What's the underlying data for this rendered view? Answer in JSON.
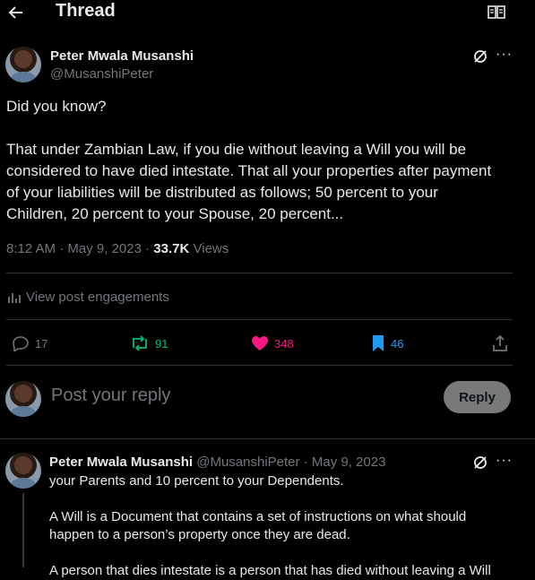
{
  "header": {
    "title": "Thread",
    "back_icon": "arrow-left-icon",
    "reader_icon": "book-open-icon"
  },
  "main_post": {
    "author_name": "Peter Mwala Musanshi",
    "author_handle": "@MusanshiPeter",
    "text_line1": "Did you know?",
    "text_line2": "That under Zambian Law, if you die without leaving a Will you will be",
    "text_line3": "considered to have died intestate. That all your properties after payment",
    "text_line4": "of your liabilities will be distributed as follows; 50 percent to your",
    "text_line5": "Children, 20 percent to your Spouse, 20 percent...",
    "time": "8:12 AM",
    "date": "May 9, 2023",
    "views_count": "33.7K",
    "views_label": "Views",
    "engagements_label": "View post engagements",
    "stats": {
      "replies": "17",
      "reposts": "91",
      "likes": "348",
      "bookmarks": "46"
    }
  },
  "reply_box": {
    "placeholder": "Post your reply",
    "button_label": "Reply"
  },
  "thread_reply": {
    "author_name": "Peter Mwala Musanshi",
    "author_handle": "@MusanshiPeter",
    "separator": "·",
    "date": "May 9, 2023",
    "line1": "your Parents and 10 percent to your Dependents.",
    "line2": "A Will is a Document that contains a set of instructions on what should",
    "line3": "happen to a person’s property once they are dead.",
    "line4": "A person that dies intestate is a person that has died without leaving a Will"
  },
  "colors": {
    "background": "#000000",
    "text": "#e7e9ea",
    "muted": "#71767b",
    "repost": "#00ba7c",
    "like": "#f91880",
    "bookmark": "#1d9bf0",
    "divider": "#2f3336"
  }
}
